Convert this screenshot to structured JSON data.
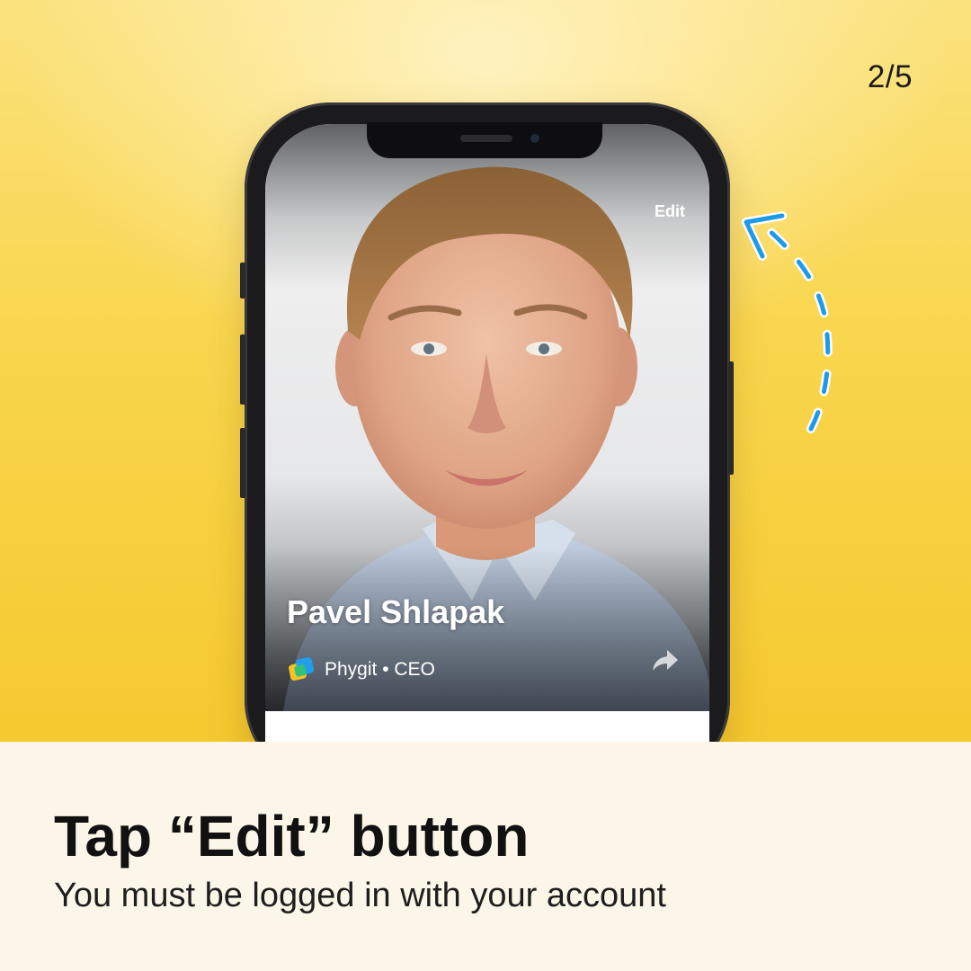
{
  "slide": {
    "counter": "2/5"
  },
  "profile": {
    "edit_label": "Edit",
    "name": "Pavel Shlapak",
    "company_line": "Phygit • CEO",
    "company_logo_icon": "phygit-logo-icon",
    "share_icon": "share-arrow-icon"
  },
  "caption": {
    "title": "Tap “Edit” button",
    "subtitle": "You must be logged in with your account"
  },
  "colors": {
    "background_yellow": "#f9d64e",
    "caption_panel": "#fbf6e8",
    "arrow_blue": "#1e9be8",
    "text_dark": "#111111"
  }
}
